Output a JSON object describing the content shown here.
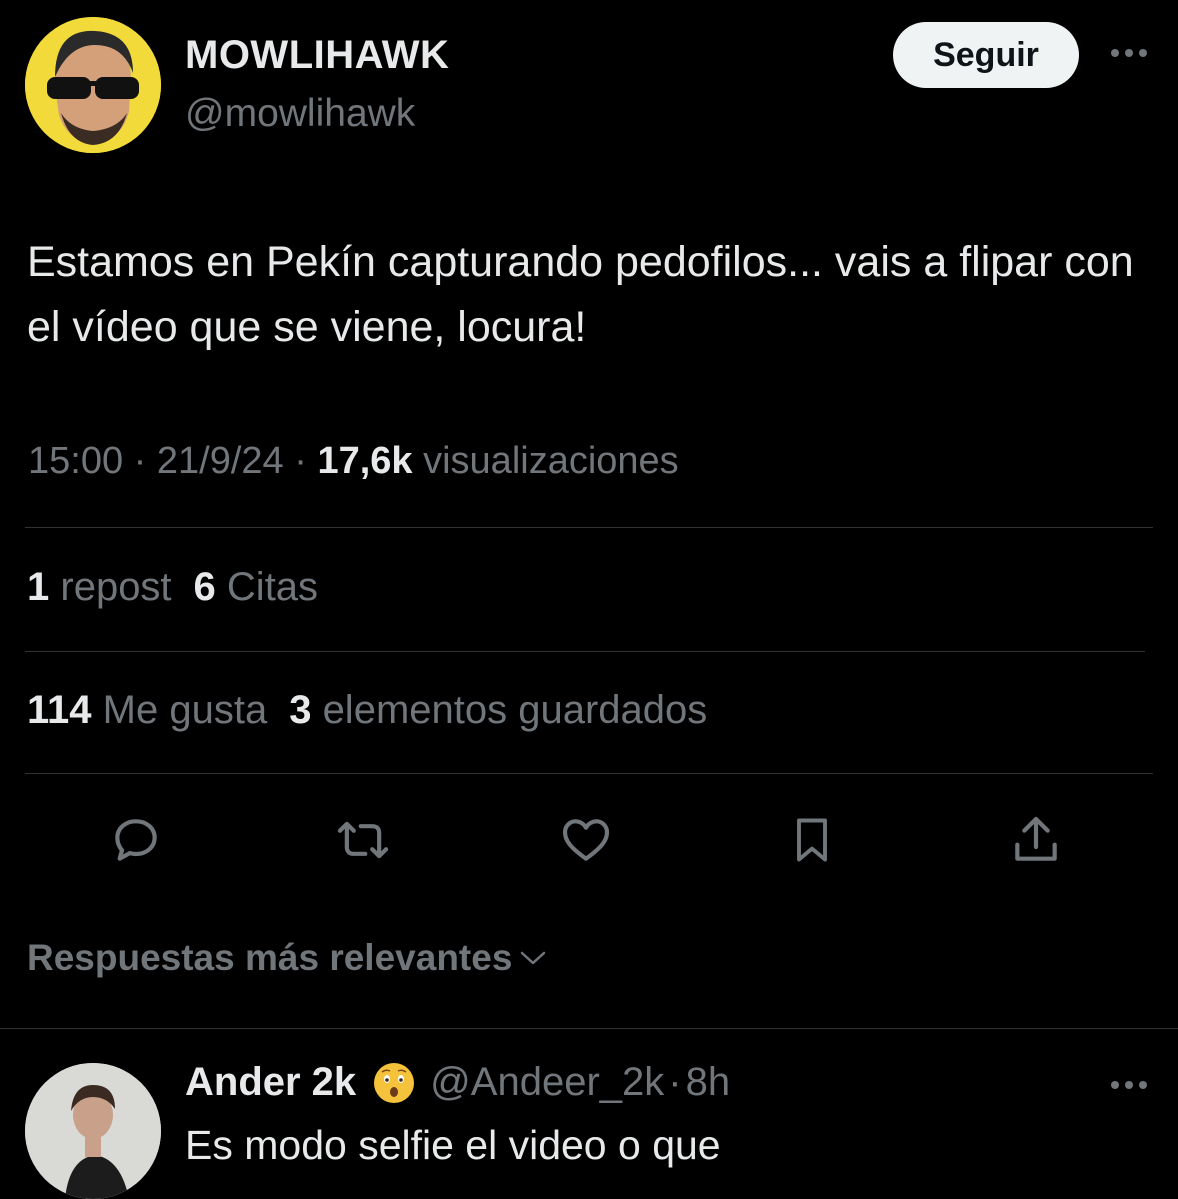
{
  "author": {
    "name": "MOWLIHAWK",
    "handle": "@mowlihawk",
    "avatar_bg": "#f2da3a"
  },
  "follow_label": "Seguir",
  "more_icon": "more-horizontal-icon",
  "tweet": {
    "text": "Estamos en Pekín capturando pedofilos... vais a flipar con el vídeo que se viene, locura!",
    "time": "15:00",
    "date": "21/9/24",
    "separator": "·",
    "views_count": "17,6k",
    "views_label": "visualizaciones"
  },
  "stats": {
    "reposts_count": "1",
    "reposts_label": "repost",
    "quotes_count": "6",
    "quotes_label": "Citas",
    "likes_count": "114",
    "likes_label": "Me gusta",
    "bookmarks_count": "3",
    "bookmarks_label": "elementos guardados"
  },
  "actions": [
    "reply-icon",
    "repost-icon",
    "like-icon",
    "bookmark-icon",
    "share-icon"
  ],
  "replies_sort_label": "Respuestas más relevantes",
  "reply": {
    "name": "Ander 2k",
    "emoji": "😲",
    "handle": "@Andeer_2k",
    "separator": "·",
    "time": "8h",
    "text": "Es modo selfie el video o que"
  },
  "colors": {
    "background": "#000000",
    "primary_text": "#e7e9ea",
    "secondary_text": "#71767b",
    "divider": "#2f3336",
    "button_bg": "#eff3f4"
  }
}
